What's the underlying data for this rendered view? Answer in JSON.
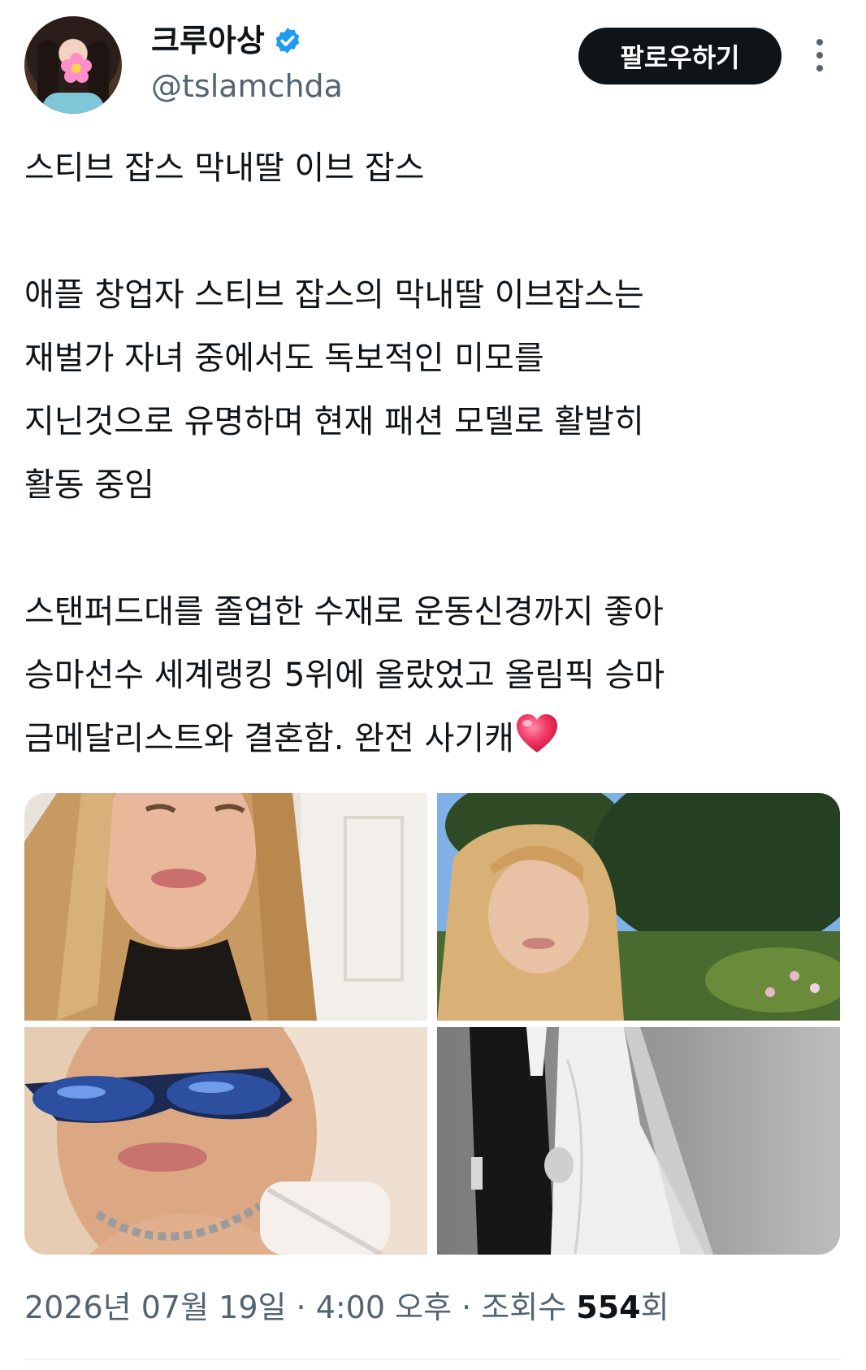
{
  "author": {
    "display_name": "크루아상",
    "handle": "@tslamchda",
    "verified": true
  },
  "actions": {
    "follow_label": "팔로우하기"
  },
  "tweet": {
    "paragraphs": [
      "스티브 잡스 막내딸 이브 잡스",
      "애플 창업자 스티브 잡스의 막내딸 이브잡스는\n재벌가 자녀 중에서도 독보적인 미모를\n지닌것으로 유명하며 현재 패션 모델로 활발히\n활동 중임",
      "스탠퍼드대를 졸업한 수재로 운동신경까지 좋아\n승마선수 세계랭킹 5위에 올랐었고 올림픽 승마\n금메달리스트와 결혼함. 완전 사기캐"
    ],
    "trailing_emoji": "heart"
  },
  "media": [
    {
      "name": "photo-closeup-portrait",
      "icon": "photo"
    },
    {
      "name": "photo-garden-portrait",
      "icon": "photo"
    },
    {
      "name": "photo-sunglasses-selfie",
      "icon": "photo"
    },
    {
      "name": "photo-wedding-couple",
      "icon": "photo"
    }
  ],
  "meta": {
    "date": "2026년 07월 19일",
    "separator_1": " · ",
    "time": "4:00 오후",
    "separator_2": " · ",
    "views_label": "조회수 ",
    "views_count": "554",
    "views_suffix": "회"
  },
  "colors": {
    "text": "#0f1419",
    "secondary": "#536471",
    "verified": "#1d9bf0",
    "follow_bg": "#0f1419"
  }
}
